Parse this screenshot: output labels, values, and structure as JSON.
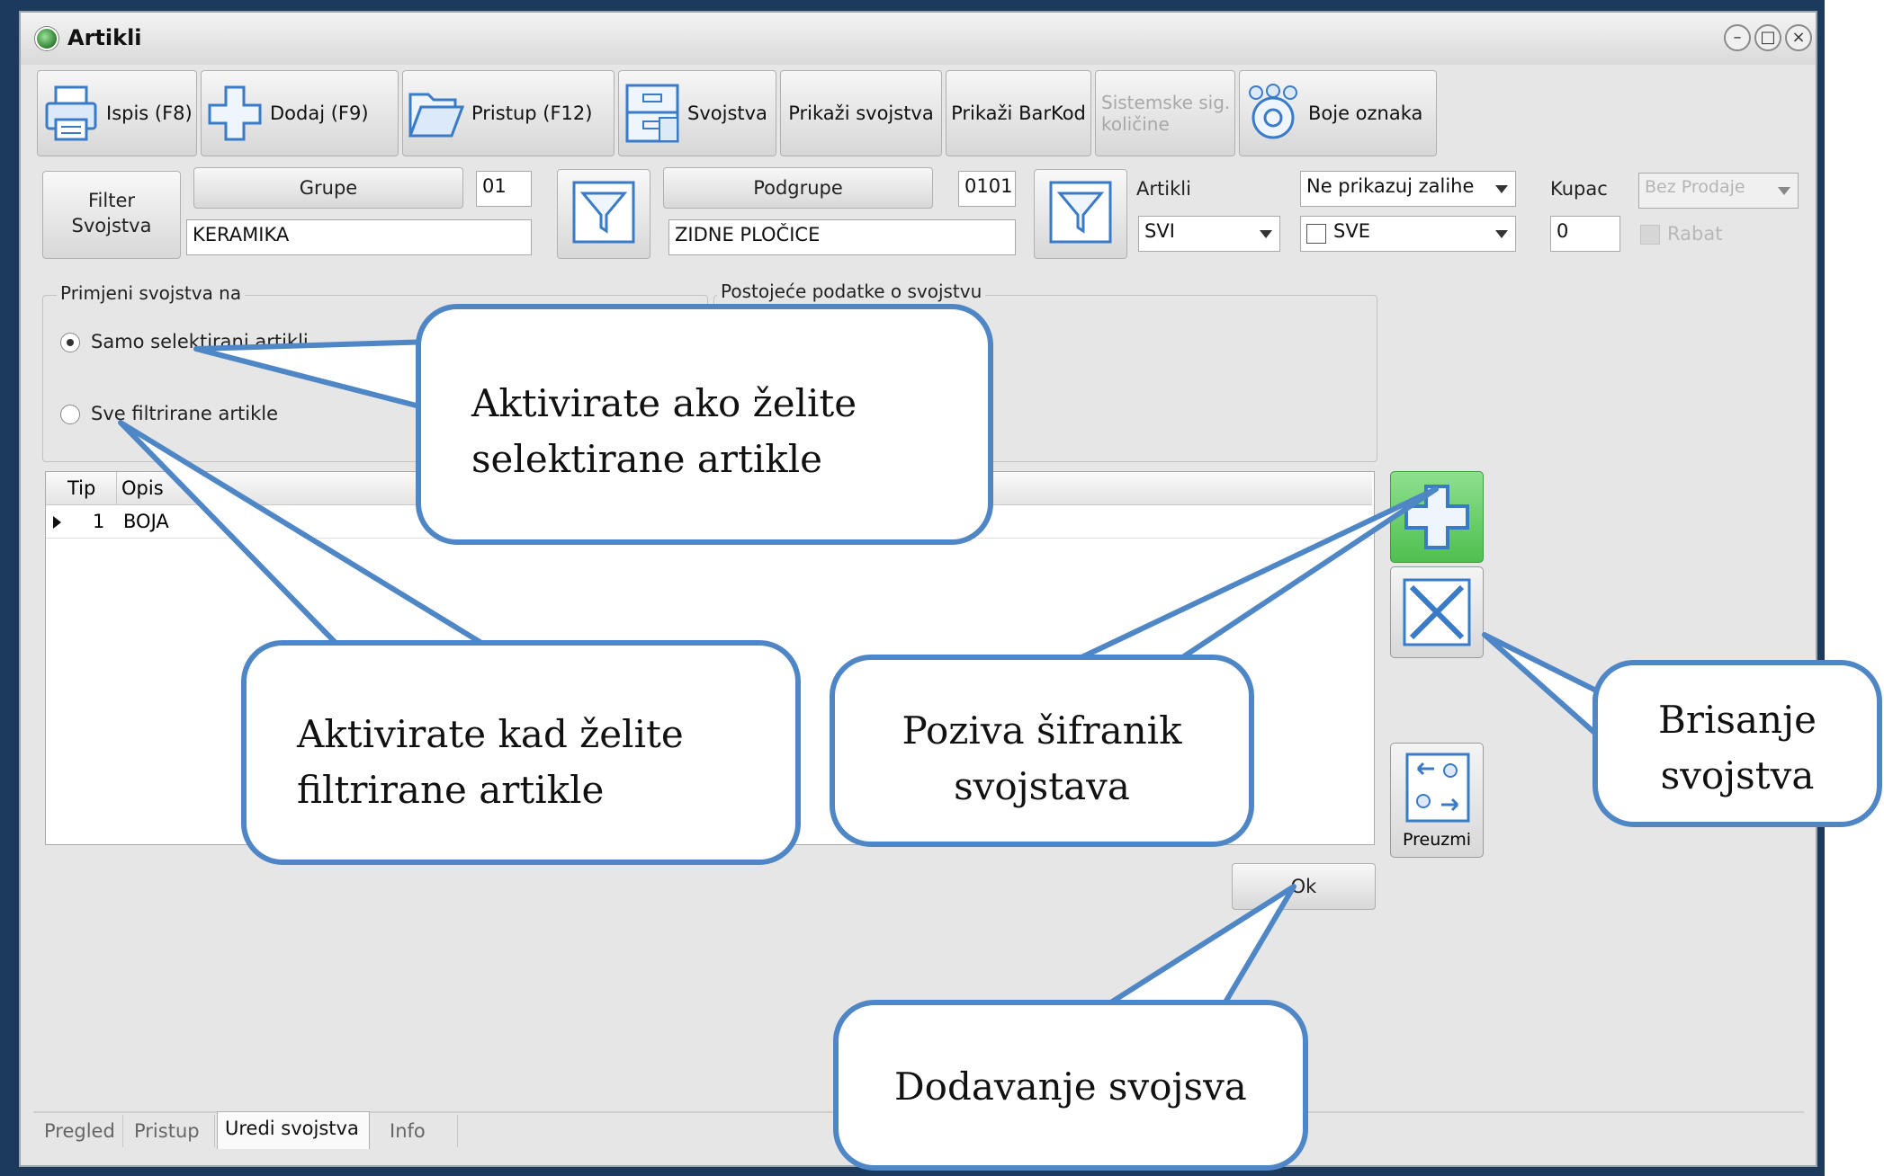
{
  "window": {
    "title": "Artikli"
  },
  "toolbar": {
    "print_label": "Ispis (F8)",
    "add_label": "Dodaj (F9)",
    "access_label": "Pristup (F12)",
    "properties_label": "Svojstva",
    "show_properties_label": "Prikaži svojstva",
    "show_barcode_label": "Prikaži BarKod",
    "system_quantities_label": "Sistemske sig. količine",
    "tag_colors_label": "Boje oznaka"
  },
  "filters": {
    "filter_properties_label": "Filter Svojstva",
    "groups_button": "Grupe",
    "groups_code": "01",
    "groups_name": "KERAMIKA",
    "subgroups_button": "Podgrupe",
    "subgroups_code": "0101",
    "subgroups_name": "ZIDNE PLOČICE",
    "articles_label": "Artikli",
    "articles_value": "SVI",
    "stock_value": "Ne prikazuj zalihe",
    "all_value": "SVE",
    "customer_label": "Kupac",
    "customer_value": "0",
    "sale_value": "Bez Prodaje",
    "discount_label": "Rabat"
  },
  "apply_group": {
    "title": "Primjeni svojstva na",
    "option_selected": "Samo selektirani artikli",
    "option_filtered": "Sve filtrirane artikle"
  },
  "existing_group": {
    "title": "Postojeće podatke o svojstvu"
  },
  "grid": {
    "headers": [
      "Tip",
      "Opis"
    ],
    "rows": [
      {
        "tip": "1",
        "opis": "BOJA"
      }
    ]
  },
  "side": {
    "take_label": "Preuzmi"
  },
  "ok_label": "Ok",
  "tabs": [
    "Pregled",
    "Pristup",
    "Uredi svojstva",
    "Info"
  ],
  "active_tab": "Uredi svojstva",
  "callouts": {
    "selected": "Aktivirate ako želite selektirane artikle",
    "filtered": "Aktivirate kad želite filtrirane artikle",
    "catalog": "Poziva šifranik svojstava",
    "delete": "Brisanje svojstva",
    "add": "Dodavanje svojsva"
  },
  "colors": {
    "callout_border": "#4f86c6",
    "background": "#1b3a5c",
    "add_button": "#5ec45e"
  }
}
